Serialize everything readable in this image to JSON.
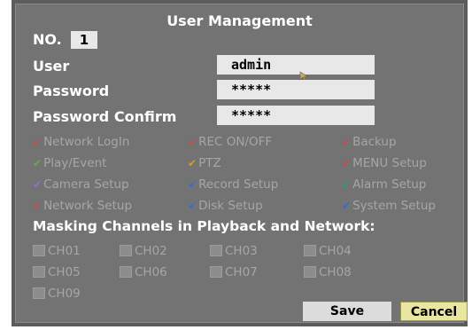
{
  "title": "User Management",
  "no": {
    "label": "NO.",
    "value": "1"
  },
  "user": {
    "label": "User",
    "value": "admin"
  },
  "password": {
    "label": "Password",
    "value": "*****"
  },
  "password_confirm": {
    "label": "Password Confirm",
    "value": "*****"
  },
  "permissions": [
    {
      "label": "Network LogIn",
      "check_color": "#c84a4a"
    },
    {
      "label": "REC ON/OFF",
      "check_color": "#c84a4a"
    },
    {
      "label": "Backup",
      "check_color": "#c84a4a"
    },
    {
      "label": "Play/Event",
      "check_color": "#6aa84f"
    },
    {
      "label": "PTZ",
      "check_color": "#d4a020"
    },
    {
      "label": "MENU Setup",
      "check_color": "#c84a4a"
    },
    {
      "label": "Camera Setup",
      "check_color": "#9a6ad0"
    },
    {
      "label": "Record Setup",
      "check_color": "#3a6ad0"
    },
    {
      "label": "Alarm Setup",
      "check_color": "#3a9a6a"
    },
    {
      "label": "Network Setup",
      "check_color": "#c84a4a"
    },
    {
      "label": "Disk Setup",
      "check_color": "#3a6ad0"
    },
    {
      "label": "System Setup",
      "check_color": "#3a6ad0"
    }
  ],
  "masking_title": "Masking Channels in Playback and Network:",
  "channels": [
    "CH01",
    "CH02",
    "CH03",
    "CH04",
    "CH05",
    "CH06",
    "CH07",
    "CH08",
    "CH09"
  ],
  "buttons": {
    "save": "Save",
    "cancel": "Cancel"
  }
}
